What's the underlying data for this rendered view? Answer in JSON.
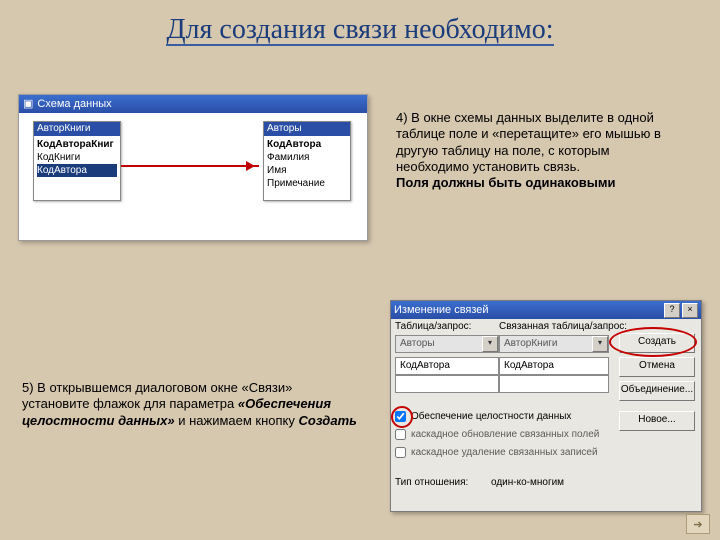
{
  "slide": {
    "title": "Для создания связи необходимо:"
  },
  "schema": {
    "window_title": "Схема данных",
    "tables": {
      "left": {
        "title": "АвторКниги",
        "fields": [
          "КодАвтораКниг",
          "КодКниги",
          "КодАвтора"
        ]
      },
      "right": {
        "title": "Авторы",
        "fields": [
          "КодАвтора",
          "Фамилия",
          "Имя",
          "Примечание"
        ]
      }
    }
  },
  "step4": {
    "text": "4) В окне схемы данных выделите в одной таблице поле и «перетащите» его мышью в другую таблицу на поле, с которым необходимо установить связь.",
    "bold": "Поля должны быть одинаковыми"
  },
  "step5": {
    "text_a": "5) В открывшемся диалоговом окне «Связи» установите флажок для параметра ",
    "em": "«Обеспечения целостности данных»",
    "text_b": " и нажимаем кнопку ",
    "em2": "Создать"
  },
  "dialog": {
    "title": "Изменение связей",
    "labels": {
      "table_query": "Таблица/запрос:",
      "related": "Связанная таблица/запрос:",
      "rel_type_lbl": "Тип отношения:",
      "rel_type_val": "один-ко-многим"
    },
    "combos": {
      "left": "Авторы",
      "right": "АвторКниги"
    },
    "fields": {
      "left": "КодАвтора",
      "right": "КодАвтора"
    },
    "buttons": {
      "create": "Создать",
      "cancel": "Отмена",
      "join": "Объединение...",
      "new": "Новое..."
    },
    "checks": {
      "integrity": "Обеспечение целостности данных",
      "cascade_update": "каскадное обновление связанных полей",
      "cascade_delete": "каскадное удаление связанных записей"
    }
  }
}
